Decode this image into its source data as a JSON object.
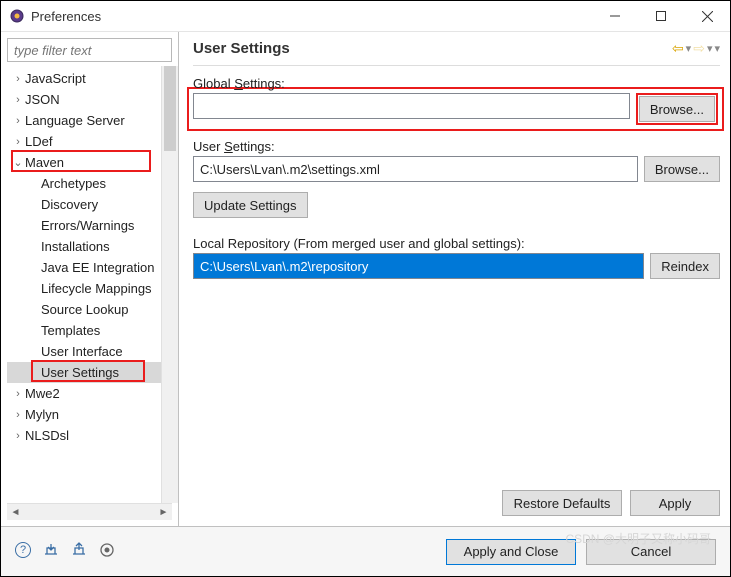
{
  "window": {
    "title": "Preferences"
  },
  "filter": {
    "placeholder": "type filter text"
  },
  "tree": {
    "items": [
      {
        "label": "JavaScript",
        "twisty": ">",
        "indent": 1
      },
      {
        "label": "JSON",
        "twisty": ">",
        "indent": 1
      },
      {
        "label": "Language Server",
        "twisty": ">",
        "indent": 1
      },
      {
        "label": "LDef",
        "twisty": ">",
        "indent": 1
      },
      {
        "label": "Maven",
        "twisty": "v",
        "indent": 1,
        "boxed": true
      },
      {
        "label": "Archetypes",
        "indent": 2
      },
      {
        "label": "Discovery",
        "indent": 2
      },
      {
        "label": "Errors/Warnings",
        "indent": 2
      },
      {
        "label": "Installations",
        "indent": 2
      },
      {
        "label": "Java EE Integration",
        "indent": 2
      },
      {
        "label": "Lifecycle Mappings",
        "indent": 2
      },
      {
        "label": "Source Lookup",
        "indent": 2
      },
      {
        "label": "Templates",
        "indent": 2
      },
      {
        "label": "User Interface",
        "indent": 2
      },
      {
        "label": "User Settings",
        "indent": 2,
        "selected": true,
        "boxed": true
      },
      {
        "label": "Mwe2",
        "twisty": ">",
        "indent": 1
      },
      {
        "label": "Mylyn",
        "twisty": ">",
        "indent": 1
      },
      {
        "label": "NLSDsl",
        "twisty": ">",
        "indent": 1
      }
    ]
  },
  "page": {
    "title": "User Settings",
    "globalLabel": "Global Settings:",
    "globalValue": "",
    "userLabel": "User Settings:",
    "userValue": "C:\\Users\\Lvan\\.m2\\settings.xml",
    "browse": "Browse...",
    "updateSettings": "Update Settings",
    "localRepoLabel": "Local Repository (From merged user and global settings):",
    "localRepoValue": "C:\\Users\\Lvan\\.m2\\repository",
    "reindex": "Reindex",
    "restoreDefaults": "Restore Defaults",
    "apply": "Apply"
  },
  "footer": {
    "applyClose": "Apply and Close",
    "cancel": "Cancel"
  },
  "watermark": "CSDN @大明子又称小码哥"
}
